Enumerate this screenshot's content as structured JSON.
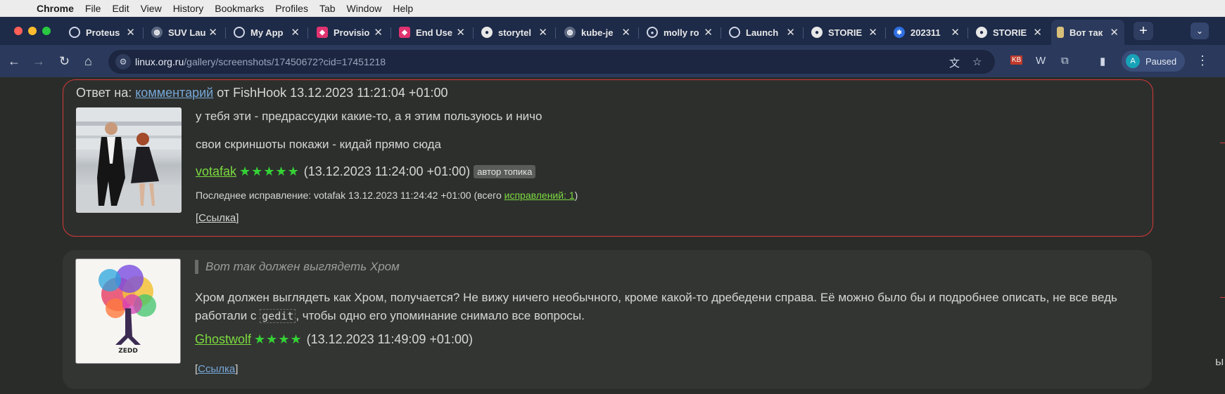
{
  "menubar": {
    "app": "Chrome",
    "items": [
      "File",
      "Edit",
      "View",
      "History",
      "Bookmarks",
      "Profiles",
      "Tab",
      "Window",
      "Help"
    ]
  },
  "tabs": [
    {
      "title": "Proteus",
      "icon": "circle-outline-icon"
    },
    {
      "title": "SUV Lau",
      "icon": "globe-icon"
    },
    {
      "title": "My App",
      "icon": "circle-outline-icon"
    },
    {
      "title": "Provisio",
      "icon": "app-icon"
    },
    {
      "title": "End Use",
      "icon": "app-icon"
    },
    {
      "title": "storytel",
      "icon": "github-icon"
    },
    {
      "title": "kube-je",
      "icon": "globe-icon"
    },
    {
      "title": "molly ro",
      "icon": "record-icon"
    },
    {
      "title": "Launch",
      "icon": "circle-outline-icon"
    },
    {
      "title": "STORIE",
      "icon": "github-icon"
    },
    {
      "title": "202311",
      "icon": "confluence-icon"
    },
    {
      "title": "STORIE",
      "icon": "github-icon"
    },
    {
      "title": "Вот так",
      "icon": "page-icon"
    }
  ],
  "toolbar": {
    "url_host": "linux.org.ru",
    "url_path": "/gallery/screenshots/17450672?cid=17451218",
    "profile_initial": "A",
    "profile_status": "Paused"
  },
  "comment1": {
    "reply_prefix": "Ответ на:",
    "reply_link": "комментарий",
    "reply_suffix": "от FishHook 13.12.2023 11:21:04 +01:00",
    "line1": "у тебя эти - предрассудки какие-то, а я этим пользуюсь и ничо",
    "line2": "свои скриншоты покажи - кидай прямо сюда",
    "author": "votafak",
    "stars": "★★★★★",
    "timestamp": "(13.12.2023 11:24:00 +01:00)",
    "badge": "автор топика",
    "edit_prefix": "Последнее исправление: votafak 13.12.2023 11:24:42 +01:00 (всего",
    "edit_link": "исправлений: 1",
    "edit_suffix": ")",
    "ref_open": "[",
    "ref_link": "Ссылка",
    "ref_close": "]"
  },
  "comment2": {
    "quote": "Вот так должен выглядеть Хром",
    "body_before": "Хром должен выглядеть как Хром, получается? Не вижу ничего необычного, кроме какой-то дребедени справа. Её можно было бы и подробнее описать, не все ведь работали с",
    "code": "gedit",
    "body_after": ", чтобы одно его упоминание снимало все вопросы.",
    "author": "Ghostwolf",
    "stars": "★★★★",
    "timestamp": "(13.12.2023 11:49:09 +01:00)",
    "ref_open": "[",
    "ref_link": "Ссылка",
    "ref_close": "]",
    "album_text": "ZEDD"
  },
  "edge_text": "ы"
}
